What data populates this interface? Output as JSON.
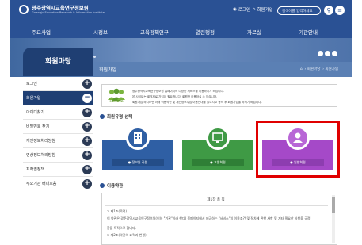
{
  "header": {
    "logo_title": "광주광역시교육연구정보원",
    "logo_sub": "Gwangju Education Research & Information Institute",
    "login": "로그인",
    "home": "회원가입",
    "search_placeholder": "검색어를 입력하세요"
  },
  "gnb": [
    "주요사업",
    "시정보",
    "교육정책연구",
    "열린행정",
    "자료실",
    "기관안내"
  ],
  "sidebar": {
    "title": "회원마당",
    "items": [
      {
        "label": "로그인",
        "active": false
      },
      {
        "label": "회원가입",
        "active": true
      },
      {
        "label": "아이디찾기",
        "active": false
      },
      {
        "label": "비밀번호 찾기",
        "active": false
      },
      {
        "label": "개인정보처리방침",
        "active": false
      },
      {
        "label": "영상정보처리방침",
        "active": false
      },
      {
        "label": "저작권정책",
        "active": false
      },
      {
        "label": "주요기관 배너모음",
        "active": false
      }
    ]
  },
  "page": {
    "title": "회원가입",
    "breadcrumb": [
      "⌂",
      "회원마당",
      "회원가입"
    ]
  },
  "member_info": {
    "label": "MEMBER",
    "lines": [
      "광주광역시교육연구정보원 홈페이지의 다양한 서비스를 이용하시기 바랍니다.",
      "본 사이트는 회원제로 가입이 필요합니다. 회원만 이용하실 수 있습니다.",
      "회원가입 하시려면 아래 이용약관 및 개인정보수집·이용안내를 읽으시고 동의 후 회원가입을 하시기 바랍니다."
    ]
  },
  "member_type": {
    "heading": "회원유형 선택",
    "cards": [
      {
        "label": "● 정보원 직원",
        "color": "#2f5fa4",
        "icon": "building-icon"
      },
      {
        "label": "● 교원회원",
        "color": "#3f9a45",
        "icon": "monitor-icon"
      },
      {
        "label": "● 일반회원",
        "color": "#a549c8",
        "icon": "person-icon"
      }
    ]
  },
  "terms": {
    "heading": "이용약관",
    "title": "제1장 총 칙",
    "lines": [
      "> 제1조(목적)",
      "이 약관은 광주광역시교육연구정보원(이하 \"기관\"이라 한다) 홈페이지에서 제공하는 \"서비스\"의 이용조건 및 절차에 관한 사항 및 기타 필요한 사항을 규정",
      "함을 목적으로 합니다.",
      "> 제2조(약관의 효력과 변경)"
    ]
  },
  "colors": {
    "brand": "#2a5194",
    "highlight": "#e00000"
  }
}
